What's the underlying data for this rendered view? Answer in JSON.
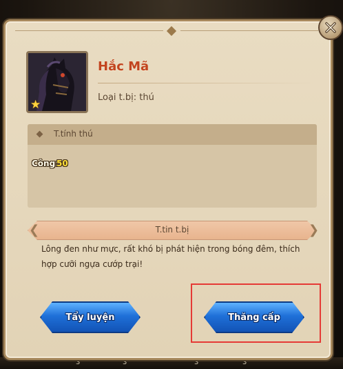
{
  "item": {
    "name": "Hắc Mã",
    "type_line": "Loại t.bị: thú",
    "star_icon": "star-icon",
    "portrait_icon": "black-horse-portrait"
  },
  "attributes": {
    "title": "T.tính thú",
    "stat_label": "Công:",
    "stat_value": "50"
  },
  "info": {
    "title": "T.tin t.bị",
    "description": "Lông đen như mực, rất khó bị phát hiện trong bóng đêm, thích hợp cưỡi ngựa cướp trại!"
  },
  "buttons": {
    "refine_label": "Tẩy luyện",
    "upgrade_label": "Thăng cấp"
  },
  "footer": {
    "numbers": [
      "3",
      "3",
      "3",
      "3"
    ]
  },
  "colors": {
    "name": "#c2451f",
    "stat_value": "#ffe03a",
    "button": "#1f70d8",
    "highlight": "#e53935"
  }
}
